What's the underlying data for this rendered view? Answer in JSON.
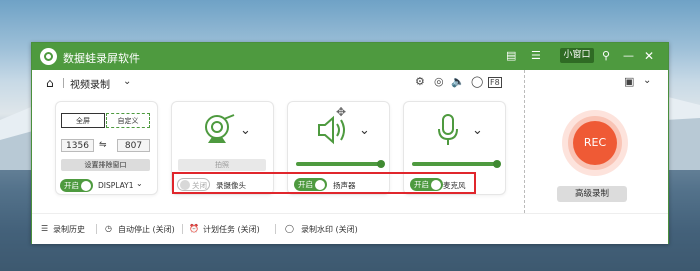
{
  "app": {
    "title": "数据蛙录屏软件",
    "small_window_label": "小窗口"
  },
  "mode": {
    "title": "视频录制"
  },
  "screen_card": {
    "fullscreen_label": "全屏",
    "custom_label": "自定义",
    "width": "1356",
    "height": "807",
    "exclude_window_label": "设置排除窗口",
    "toggle_label": "开启",
    "display_label": "DISPLAY1"
  },
  "camera_card": {
    "snapshot_label": "拍照",
    "toggle_label": "关闭",
    "device_label": "录摄像头"
  },
  "speaker_card": {
    "toggle_label": "开启",
    "device_label": "扬声器",
    "volume": 100
  },
  "mic_card": {
    "toggle_label": "开启",
    "device_label": "麦克风",
    "volume": 100
  },
  "record": {
    "rec_label": "REC",
    "advanced_label": "高级录制"
  },
  "bottom_bar": {
    "history": "录制历史",
    "auto_stop": "自动停止 (关闭)",
    "schedule": "计划任务 (关闭)",
    "watermark": "录制水印 (关闭)"
  },
  "colors": {
    "accent": "#4e9a3f",
    "rec": "#ef5a35",
    "highlight_border": "#e0262c"
  }
}
